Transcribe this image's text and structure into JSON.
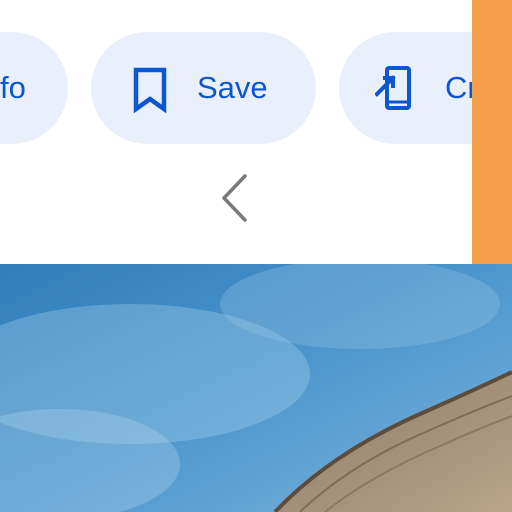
{
  "actions": {
    "info_label": "fo",
    "save_label": "Save",
    "create_label": "Cr"
  },
  "icons": {
    "save": "bookmark-icon",
    "create": "add-to-device-icon",
    "back": "chevron-left-icon"
  },
  "colors": {
    "accent": "#0b57d0",
    "chip_background": "#e9f0fb",
    "side_strip": "#f7a04b",
    "chevron": "#7a7a7a",
    "sky": "#3f8bc3"
  }
}
